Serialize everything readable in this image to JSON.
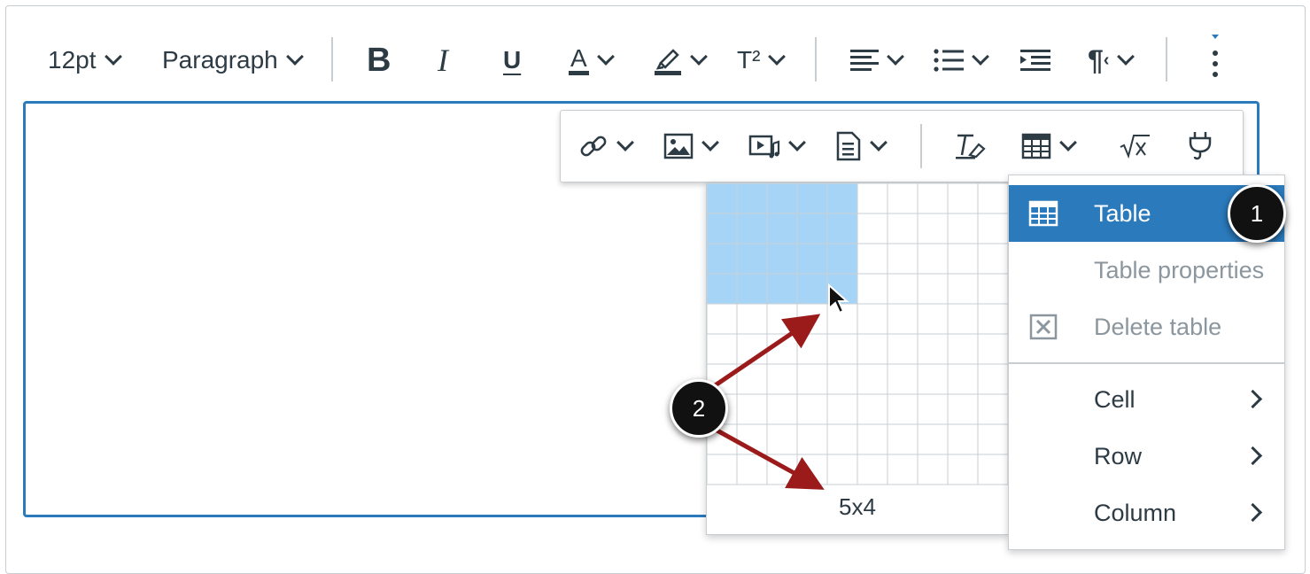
{
  "toolbar": {
    "font_size": "12pt",
    "block_format": "Paragraph",
    "bold": "B",
    "italic": "I",
    "underline": "U",
    "text_color": "A",
    "superscript": "T²",
    "pilcrow": "¶"
  },
  "table_grid": {
    "rows": 10,
    "cols": 10,
    "selected_cols": 5,
    "selected_rows": 4,
    "size_label": "5x4"
  },
  "table_menu": {
    "items": [
      {
        "label": "Table",
        "icon": "table-icon",
        "state": "active"
      },
      {
        "label": "Table properties",
        "icon": "",
        "state": "disabled"
      },
      {
        "label": "Delete table",
        "icon": "delete-table-icon",
        "state": "disabled"
      },
      {
        "label": "Cell",
        "submenu": true
      },
      {
        "label": "Row",
        "submenu": true
      },
      {
        "label": "Column",
        "submenu": true
      }
    ]
  },
  "callouts": {
    "one": "1",
    "two": "2"
  },
  "colors": {
    "accent": "#2b7abc",
    "selection": "#a6d4f7",
    "callout_arrow": "#9b1b1b",
    "text": "#2d3b45"
  }
}
